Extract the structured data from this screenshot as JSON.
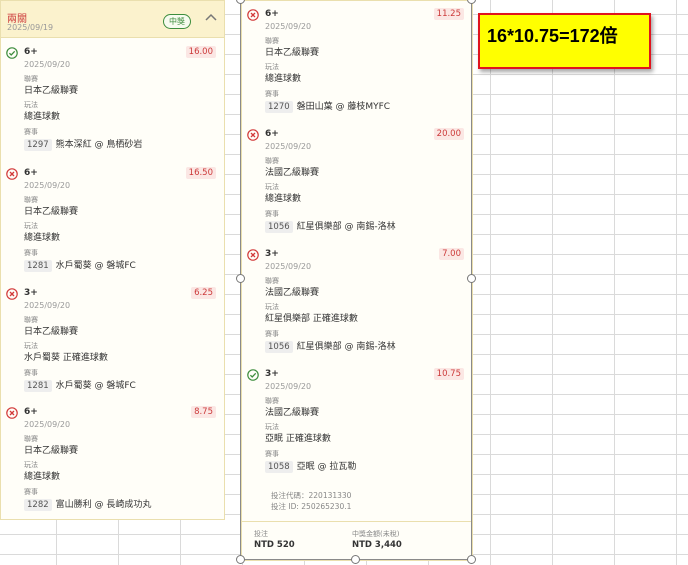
{
  "left_card": {
    "header": {
      "title": "兩關",
      "date": "2025/09/19",
      "badge": "中獎"
    },
    "bets": [
      {
        "status": "won",
        "status_icon": "check-circle-icon",
        "title": "6+",
        "date": "2025/09/20",
        "odds": "16.00",
        "league_label": "聯賽",
        "league": "日本乙級聯賽",
        "play_label": "玩法",
        "play": "總進球數",
        "match_label": "賽事",
        "match_no": "1297",
        "match": "熊本深紅 @ 鳥栖砂岩"
      },
      {
        "status": "lost",
        "status_icon": "x-circle-icon",
        "title": "6+",
        "date": "2025/09/20",
        "odds": "16.50",
        "league_label": "聯賽",
        "league": "日本乙級聯賽",
        "play_label": "玩法",
        "play": "總進球數",
        "match_label": "賽事",
        "match_no": "1281",
        "match": "水戶蜀葵 @ 磐城FC"
      },
      {
        "status": "lost",
        "status_icon": "x-circle-icon",
        "title": "3+",
        "date": "2025/09/20",
        "odds": "6.25",
        "league_label": "聯賽",
        "league": "日本乙級聯賽",
        "play_label": "玩法",
        "play": "水戶蜀葵 正確進球數",
        "match_label": "賽事",
        "match_no": "1281",
        "match": "水戶蜀葵 @ 磐城FC"
      },
      {
        "status": "lost",
        "status_icon": "x-circle-icon",
        "title": "6+",
        "date": "2025/09/20",
        "odds": "8.75",
        "league_label": "聯賽",
        "league": "日本乙級聯賽",
        "play_label": "玩法",
        "play": "總進球數",
        "match_label": "賽事",
        "match_no": "1282",
        "match": "富山勝利 @ 長崎成功丸"
      }
    ]
  },
  "right_card": {
    "bets": [
      {
        "status": "lost",
        "status_icon": "x-circle-icon",
        "title": "6+",
        "date": "2025/09/20",
        "odds": "11.25",
        "league_label": "聯賽",
        "league": "日本乙級聯賽",
        "play_label": "玩法",
        "play": "總進球數",
        "match_label": "賽事",
        "match_no": "1270",
        "match": "磐田山葉 @ 藤枝MYFC"
      },
      {
        "status": "lost",
        "status_icon": "x-circle-icon",
        "title": "6+",
        "date": "2025/09/20",
        "odds": "20.00",
        "league_label": "聯賽",
        "league": "法國乙級聯賽",
        "play_label": "玩法",
        "play": "總進球數",
        "match_label": "賽事",
        "match_no": "1056",
        "match": "紅星俱樂部 @ 南錫-洛林"
      },
      {
        "status": "lost",
        "status_icon": "x-circle-icon",
        "title": "3+",
        "date": "2025/09/20",
        "odds": "7.00",
        "league_label": "聯賽",
        "league": "法國乙級聯賽",
        "play_label": "玩法",
        "play": "紅星俱樂部 正確進球數",
        "match_label": "賽事",
        "match_no": "1056",
        "match": "紅星俱樂部 @ 南錫-洛林"
      },
      {
        "status": "won",
        "status_icon": "check-circle-icon",
        "title": "3+",
        "date": "2025/09/20",
        "odds": "10.75",
        "league_label": "聯賽",
        "league": "法國乙級聯賽",
        "play_label": "玩法",
        "play": "亞眠 正確進球數",
        "match_label": "賽事",
        "match_no": "1058",
        "match": "亞眠 @ 拉瓦勒"
      }
    ],
    "bet_code": "投注代碼：220131330",
    "bet_id": "投注 ID: 250265230.1",
    "stake_label": "投注",
    "stake": "NTD 520",
    "payout_label": "中獎金額(未稅)",
    "payout": "NTD 3,440"
  },
  "annotation": {
    "text": "16*10.75=172倍"
  },
  "colors": {
    "won": "#3d8d3d",
    "lost": "#d23a3a",
    "odds_bg": "#fbe7e4",
    "annotation_bg": "#ffff00",
    "annotation_border": "#e0141e"
  }
}
